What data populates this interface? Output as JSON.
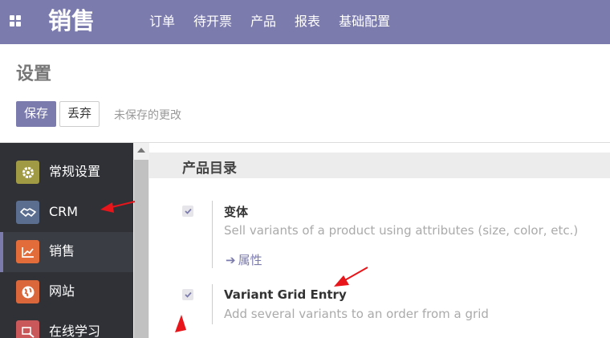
{
  "header": {
    "app_title": "销售",
    "menu": [
      "订单",
      "待开票",
      "产品",
      "报表",
      "基础配置"
    ]
  },
  "control": {
    "page_title": "设置",
    "save_label": "保存",
    "discard_label": "丢弃",
    "unsaved_text": "未保存的更改"
  },
  "sidebar": {
    "items": [
      {
        "label": "常规设置",
        "icon": "gear-icon",
        "color": "#a19a45"
      },
      {
        "label": "CRM",
        "icon": "handshake-icon",
        "color": "#5b6e8f"
      },
      {
        "label": "销售",
        "icon": "chart-icon",
        "color": "#e26d3b"
      },
      {
        "label": "网站",
        "icon": "globe-icon",
        "color": "#d9673b"
      },
      {
        "label": "在线学习",
        "icon": "elearning-icon",
        "color": "#c9585b"
      }
    ],
    "active_index": 2
  },
  "content": {
    "section_title": "产品目录",
    "settings": [
      {
        "title": "变体",
        "description": "Sell variants of a product using attributes (size, color, etc.)",
        "link": "属性",
        "checked": true
      },
      {
        "title": "Variant Grid Entry",
        "description": "Add several variants to an order from a grid",
        "checked": true
      }
    ]
  },
  "colors": {
    "brand": "#7c7bad",
    "annotation": "#e8151a"
  }
}
